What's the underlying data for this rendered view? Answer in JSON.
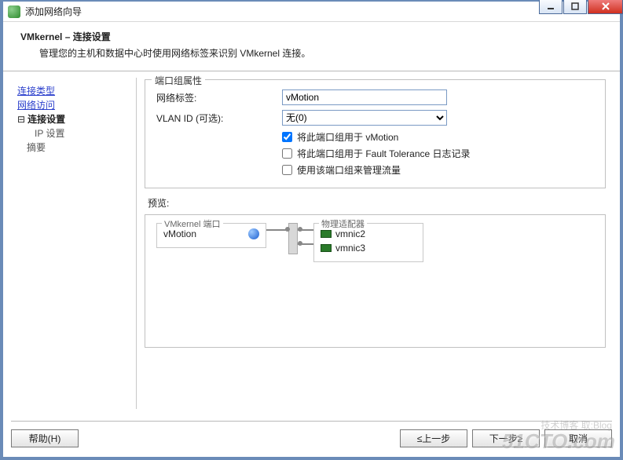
{
  "window": {
    "title": "添加网络向导"
  },
  "header": {
    "title": "VMkernel – 连接设置",
    "subtitle": "管理您的主机和数据中心时使用网络标签来识别 VMkernel 连接。"
  },
  "nav": {
    "step1": "连接类型",
    "step2": "网络访问",
    "current": "连接设置",
    "sub1": "IP 设置",
    "step4": "摘要"
  },
  "group": {
    "legend": "端口组属性",
    "label_net": "网络标签:",
    "label_vlan": "VLAN ID (可选):",
    "input_value": "vMotion",
    "vlan_value": "无(0)",
    "chk1": "将此端口组用于 vMotion",
    "chk2": "将此端口组用于 Fault Tolerance 日志记录",
    "chk3": "使用该端口组来管理流量"
  },
  "preview": {
    "label": "预览:",
    "vmk_legend": "VMkernel 端口",
    "vmk_item": "vMotion",
    "phys_legend": "物理适配器",
    "nic1": "vmnic2",
    "nic2": "vmnic3"
  },
  "footer": {
    "help": "帮助(H)",
    "back": "≤上一步",
    "next": "下一步≥",
    "cancel": "取消"
  },
  "watermark": {
    "big": "51CTO.com",
    "small": "技术博客 取:Blog"
  }
}
